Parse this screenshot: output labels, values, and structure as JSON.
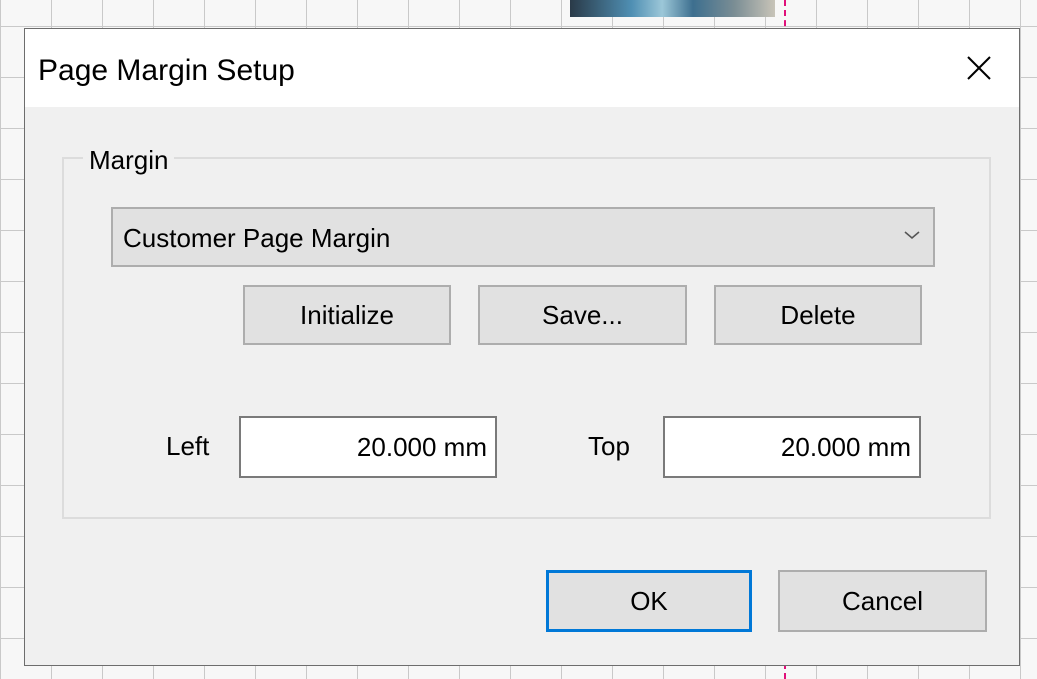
{
  "dialog": {
    "title": "Page Margin Setup",
    "close_icon": "close-icon"
  },
  "margin_group": {
    "label": "Margin",
    "preset": {
      "selected": "Customer Page Margin",
      "arrow_icon": "chevron-down-icon"
    },
    "buttons": {
      "initialize": "Initialize",
      "save": "Save...",
      "delete": "Delete"
    },
    "left": {
      "label": "Left",
      "value": "20.000 mm"
    },
    "top": {
      "label": "Top",
      "value": "20.000 mm"
    }
  },
  "footer": {
    "ok": "OK",
    "cancel": "Cancel"
  },
  "colors": {
    "dialog_bg": "#f0f0f0",
    "title_bg": "#ffffff",
    "button_bg": "#e1e1e1",
    "button_border": "#adadad",
    "default_button_border": "#0078d7",
    "guide_line": "#e0107a"
  }
}
